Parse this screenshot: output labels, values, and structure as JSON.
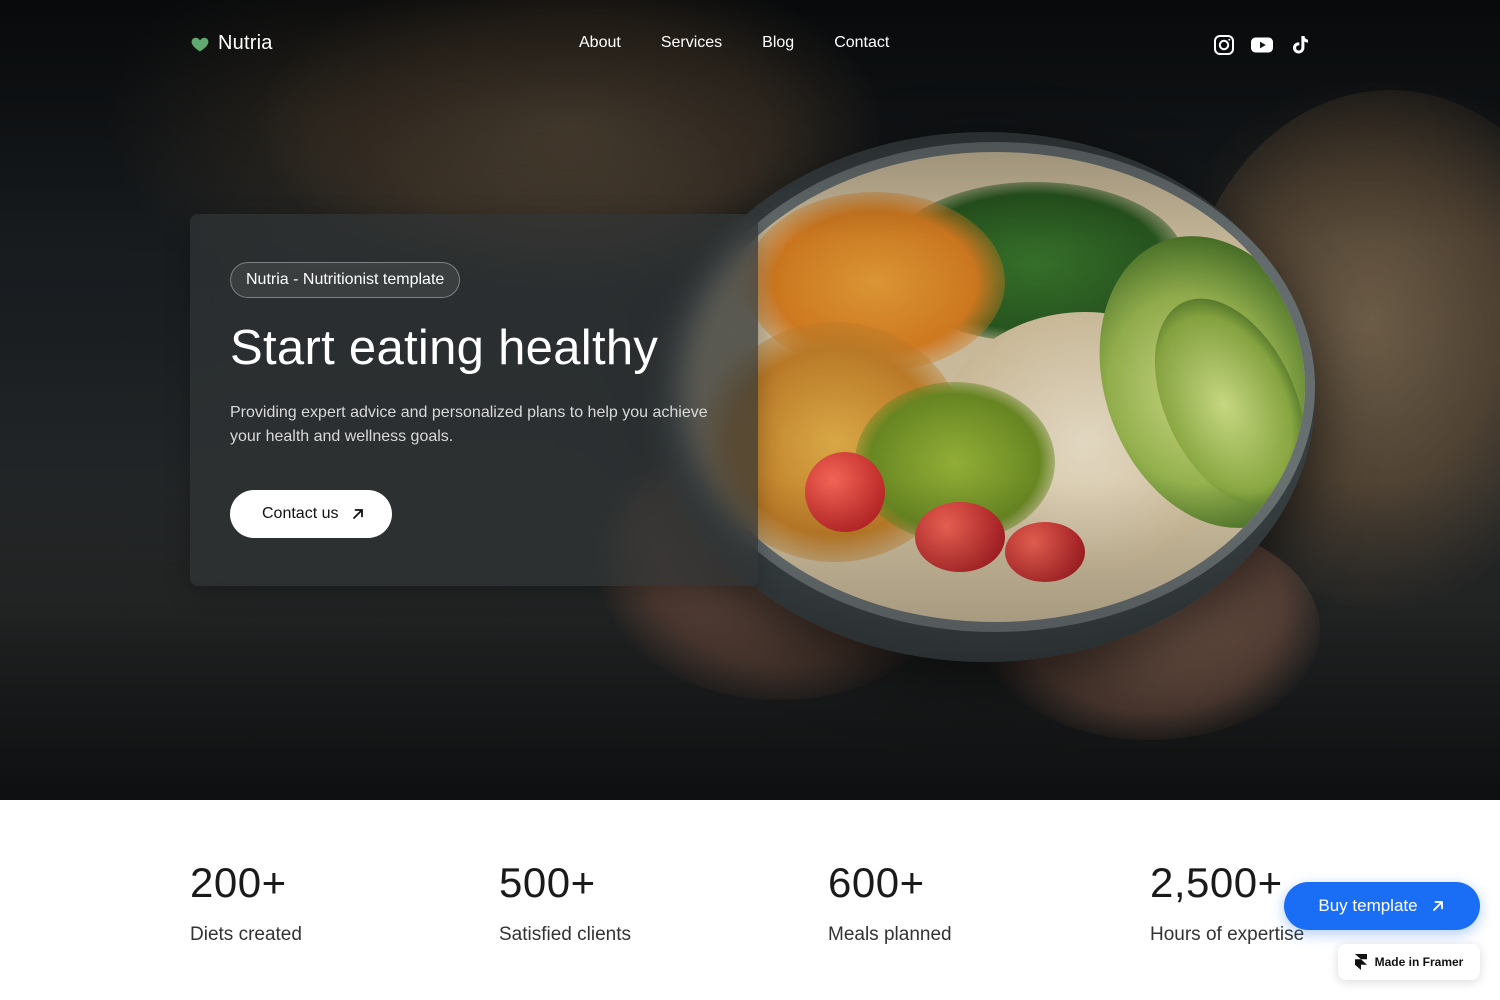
{
  "brand": {
    "name": "Nutria",
    "accent": "#5fa86f"
  },
  "nav": {
    "links": [
      {
        "label": "About"
      },
      {
        "label": "Services"
      },
      {
        "label": "Blog"
      },
      {
        "label": "Contact"
      }
    ],
    "socials": [
      {
        "icon": "instagram-icon"
      },
      {
        "icon": "youtube-icon"
      },
      {
        "icon": "tiktok-icon"
      }
    ]
  },
  "hero": {
    "tag": "Nutria - Nutritionist template",
    "headline": "Start eating healthy",
    "subtext": "Providing expert advice and personalized plans to help you achieve your health and wellness goals.",
    "cta_label": "Contact us",
    "cta_icon": "arrow-up-right-icon"
  },
  "stats": [
    {
      "value": "200+",
      "label": "Diets created"
    },
    {
      "value": "500+",
      "label": "Satisfied clients"
    },
    {
      "value": "600+",
      "label": "Meals planned"
    },
    {
      "value": "2,500+",
      "label": "Hours of expertise"
    }
  ],
  "floating": {
    "buy_label": "Buy template",
    "buy_color": "#1a6ef5",
    "framer_label": "Made in Framer"
  }
}
